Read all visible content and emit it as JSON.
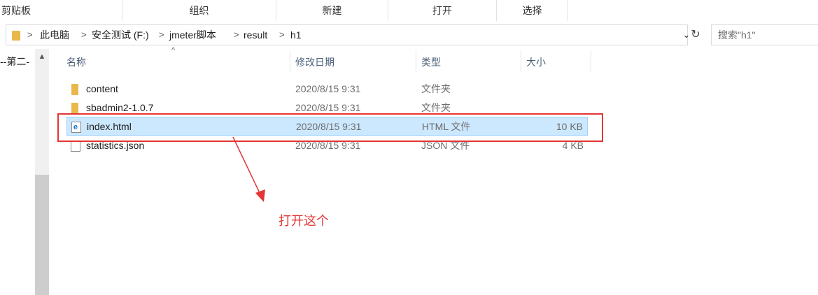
{
  "ribbon": {
    "groups": [
      "剪贴板",
      "组织",
      "新建",
      "打开",
      "选择"
    ]
  },
  "address": {
    "crumbs": [
      "此电脑",
      "安全测试 (F:)",
      "jmeter脚本",
      "result",
      "h1"
    ],
    "separator": ">",
    "dropdown_icon": "chevron-down-icon",
    "refresh_icon": "refresh-icon"
  },
  "search": {
    "placeholder": "搜索\"h1\""
  },
  "nav": {
    "text": "--第二-"
  },
  "columns": {
    "name": "名称",
    "date": "修改日期",
    "type": "类型",
    "size": "大小"
  },
  "files": [
    {
      "name": "content",
      "date": "2020/8/15 9:31",
      "type": "文件夹",
      "size": "",
      "icon": "folder-icon"
    },
    {
      "name": "sbadmin2-1.0.7",
      "date": "2020/8/15 9:31",
      "type": "文件夹",
      "size": "",
      "icon": "folder-icon"
    },
    {
      "name": "index.html",
      "date": "2020/8/15 9:31",
      "type": "HTML 文件",
      "size": "10 KB",
      "icon": "html-file-icon",
      "selected": true
    },
    {
      "name": "statistics.json",
      "date": "2020/8/15 9:31",
      "type": "JSON 文件",
      "size": "4 KB",
      "icon": "json-file-icon"
    }
  ],
  "annotation": {
    "text": "打开这个",
    "color": "#e43535"
  },
  "colors": {
    "selection": "#cce8ff",
    "selection_border": "#99d1ff",
    "folder": "#e8b84a",
    "header_text": "#4c607a"
  }
}
